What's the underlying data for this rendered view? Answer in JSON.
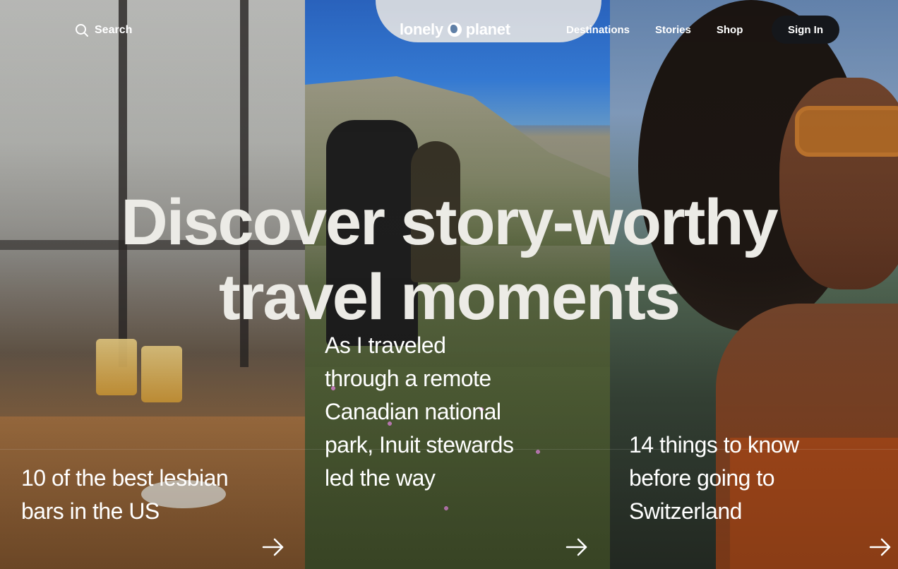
{
  "header": {
    "search_label": "Search",
    "logo_text_left": "lonely",
    "logo_text_right": "planet",
    "nav": [
      {
        "label": "Destinations"
      },
      {
        "label": "Stories"
      },
      {
        "label": "Shop"
      }
    ],
    "signin_label": "Sign In"
  },
  "hero": {
    "headline_line1": "Discover story-worthy",
    "headline_line2": "travel moments"
  },
  "stories": [
    {
      "title": "10 of the best lesbian bars in the US"
    },
    {
      "title": "As I traveled through a remote Canadian national park, Inuit stewards led the way"
    },
    {
      "title": "14 things to know before going to Switzerland"
    }
  ],
  "icons": {
    "search": "search-icon",
    "logo": "globe-icon",
    "arrow": "arrow-right-icon"
  }
}
